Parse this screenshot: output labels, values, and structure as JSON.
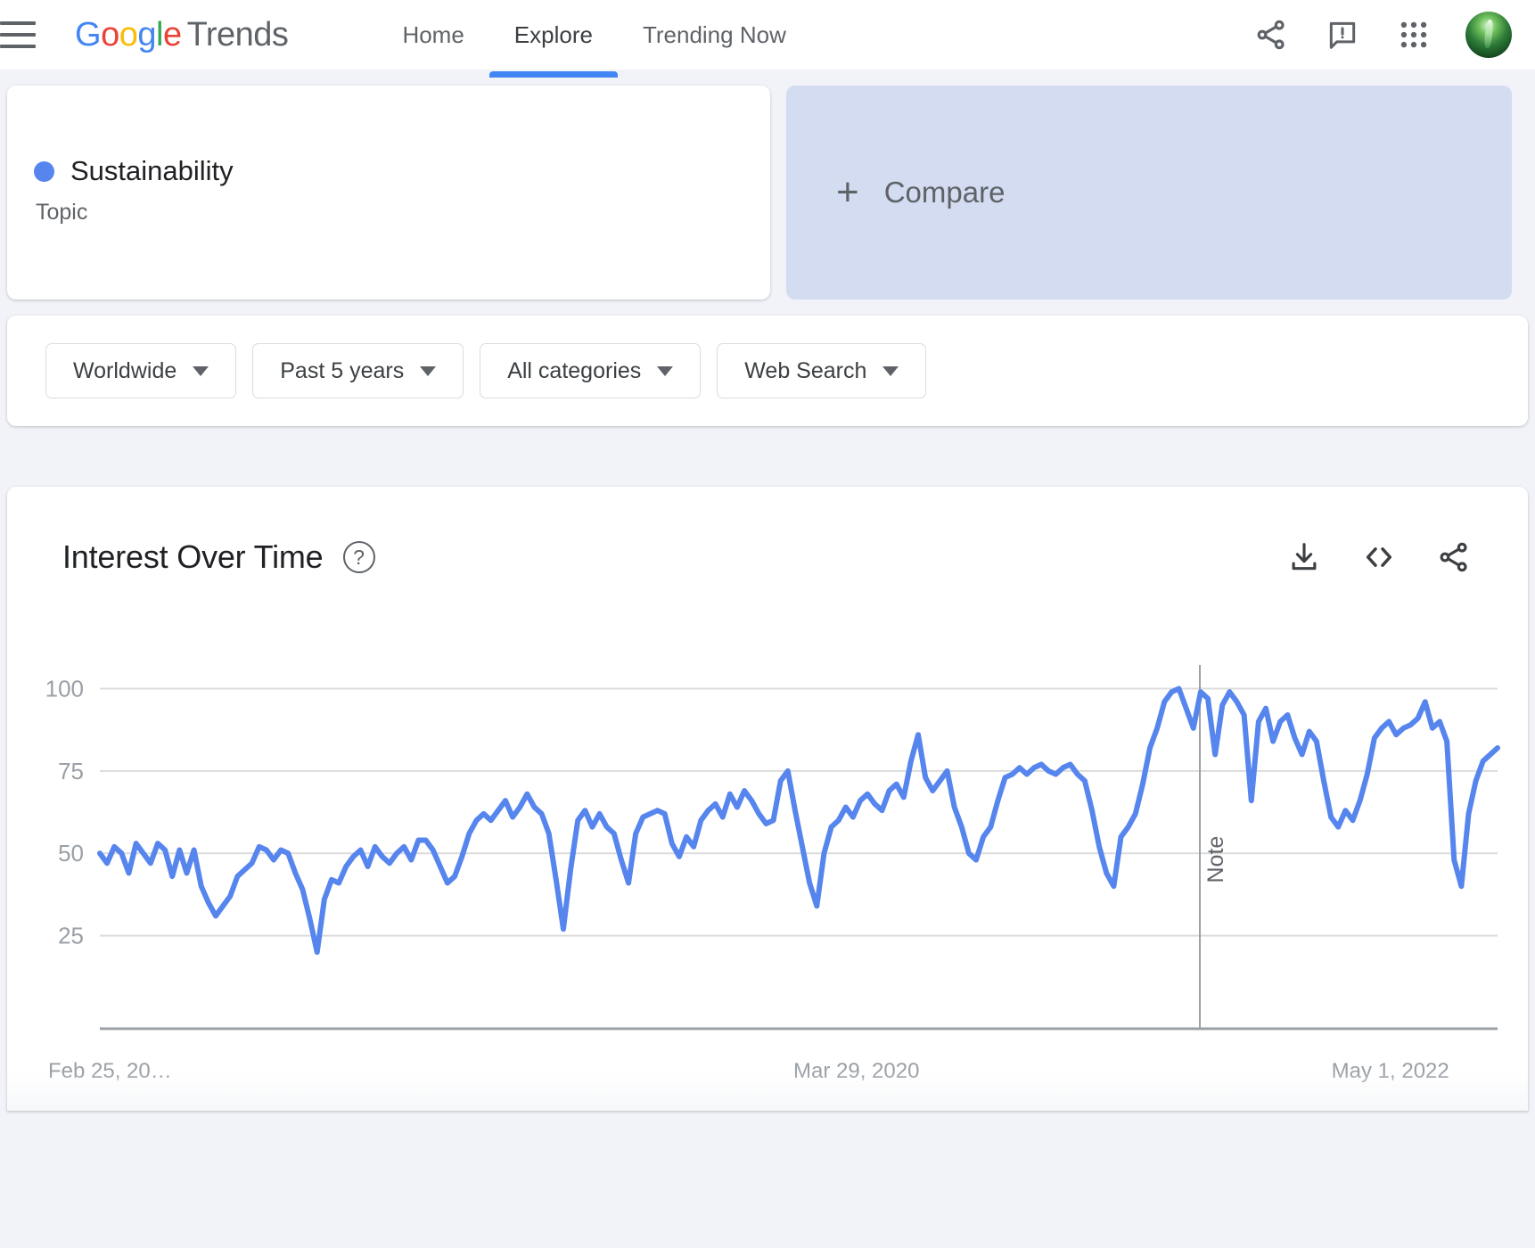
{
  "header": {
    "menu_icon": "hamburger-icon",
    "logo": {
      "google": "Google",
      "product": "Trends"
    },
    "nav": [
      {
        "label": "Home",
        "active": false
      },
      {
        "label": "Explore",
        "active": true
      },
      {
        "label": "Trending Now",
        "active": false
      }
    ],
    "actions": [
      {
        "name": "share-icon",
        "label": "Share"
      },
      {
        "name": "feedback-icon",
        "label": "Send feedback"
      },
      {
        "name": "apps-grid-icon",
        "label": "Google apps"
      },
      {
        "name": "avatar",
        "label": "Account"
      }
    ]
  },
  "query": {
    "term_label": "Sustainability",
    "term_type": "Topic",
    "term_color": "#5685ED",
    "compare_label": "Compare",
    "compare_plus": "+"
  },
  "filters": [
    {
      "name": "location-filter",
      "label": "Worldwide"
    },
    {
      "name": "time-range-filter",
      "label": "Past 5 years"
    },
    {
      "name": "category-filter",
      "label": "All categories"
    },
    {
      "name": "search-type-filter",
      "label": "Web Search"
    }
  ],
  "interest_panel": {
    "title": "Interest Over Time",
    "help": "?",
    "actions": [
      {
        "name": "download-csv-button",
        "label": "Download CSV"
      },
      {
        "name": "embed-code-button",
        "label": "Embed code"
      },
      {
        "name": "share-chart-button",
        "label": "Share"
      }
    ],
    "note_label": "Note"
  },
  "chart_data": {
    "type": "line",
    "title": "Interest Over Time",
    "xlabel": "",
    "ylabel": "",
    "ylim": [
      0,
      105
    ],
    "yticks": [
      25,
      50,
      75,
      100
    ],
    "grid": true,
    "legend": false,
    "line_color": "#5685ED",
    "line_width": 6,
    "x_tick_labels": [
      "Feb 25, 20…",
      "Mar 29, 2020",
      "May 1, 2022"
    ],
    "x_tick_positions": [
      0,
      0.5,
      0.885
    ],
    "annotations": [
      {
        "label": "Note",
        "x_fraction": 0.787,
        "orientation": "vertical"
      }
    ],
    "series": [
      {
        "name": "Sustainability",
        "color": "#5685ED",
        "values": [
          50,
          47,
          52,
          50,
          44,
          53,
          50,
          47,
          53,
          51,
          43,
          51,
          44,
          51,
          40,
          35,
          31,
          34,
          37,
          43,
          45,
          47,
          52,
          51,
          48,
          51,
          50,
          44,
          39,
          30,
          20,
          36,
          42,
          41,
          46,
          49,
          51,
          46,
          52,
          49,
          47,
          50,
          52,
          48,
          54,
          54,
          51,
          46,
          41,
          43,
          49,
          56,
          60,
          62,
          60,
          63,
          66,
          61,
          64,
          68,
          64,
          62,
          56,
          42,
          27,
          45,
          60,
          63,
          58,
          62,
          58,
          56,
          48,
          41,
          56,
          61,
          62,
          63,
          62,
          53,
          49,
          55,
          52,
          60,
          63,
          65,
          61,
          68,
          64,
          69,
          66,
          62,
          59,
          60,
          72,
          75,
          63,
          52,
          41,
          34,
          50,
          58,
          60,
          64,
          61,
          66,
          68,
          65,
          63,
          69,
          71,
          67,
          78,
          86,
          73,
          69,
          72,
          75,
          64,
          58,
          50,
          48,
          55,
          58,
          66,
          73,
          74,
          76,
          74,
          76,
          77,
          75,
          74,
          76,
          77,
          74,
          72,
          63,
          52,
          44,
          40,
          55,
          58,
          62,
          71,
          82,
          88,
          96,
          99,
          100,
          94,
          88,
          99,
          97,
          80,
          95,
          99,
          96,
          92,
          66,
          90,
          94,
          84,
          90,
          92,
          85,
          80,
          87,
          84,
          72,
          61,
          58,
          63,
          60,
          66,
          74,
          85,
          88,
          90,
          86,
          88,
          89,
          91,
          96,
          88,
          90,
          84,
          48,
          40,
          62,
          72,
          78,
          80,
          82
        ]
      }
    ]
  }
}
